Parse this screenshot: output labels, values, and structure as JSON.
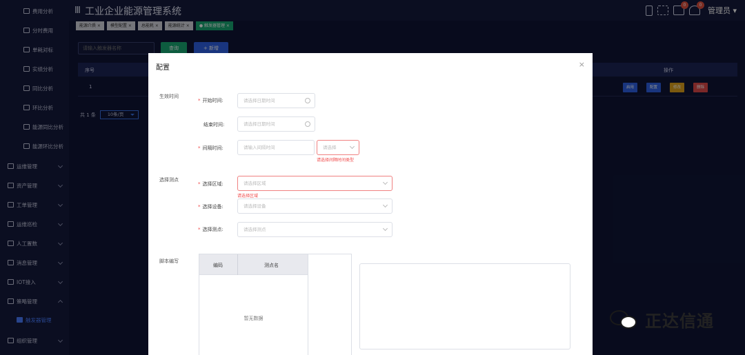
{
  "sidebar": {
    "items": [
      {
        "label": "费用分析",
        "icon": "home-icon",
        "level": "child"
      },
      {
        "label": "分时费用",
        "icon": "calendar-icon",
        "level": "child"
      },
      {
        "label": "单耗对标",
        "icon": "user-icon",
        "level": "child"
      },
      {
        "label": "实绩分析",
        "icon": "monitor-icon",
        "level": "child"
      },
      {
        "label": "同比分析",
        "icon": "calendar-icon",
        "level": "child"
      },
      {
        "label": "环比分析",
        "icon": "grid-icon",
        "level": "child"
      },
      {
        "label": "能源同比分析",
        "icon": "chart-icon",
        "level": "child"
      },
      {
        "label": "能源环比分析",
        "icon": "table-icon",
        "level": "child"
      },
      {
        "label": "运维管理",
        "icon": "warning-icon",
        "level": "group"
      },
      {
        "label": "资产管理",
        "icon": "image-icon",
        "level": "group"
      },
      {
        "label": "工单管理",
        "icon": "monitor-icon",
        "level": "group"
      },
      {
        "label": "运维巡检",
        "icon": "user-icon",
        "level": "group"
      },
      {
        "label": "人工置数",
        "icon": "person-card-icon",
        "level": "group"
      },
      {
        "label": "消息管理",
        "icon": "message-icon",
        "level": "group"
      },
      {
        "label": "IOT接入",
        "icon": "iot-icon",
        "level": "group"
      },
      {
        "label": "策略管理",
        "icon": "monitor-icon",
        "level": "group"
      },
      {
        "label": "触发器管理",
        "icon": "monitor-icon",
        "level": "active"
      },
      {
        "label": "组织管理",
        "icon": "org-icon",
        "level": "group"
      }
    ]
  },
  "header": {
    "title": "工业企业能源管理系统",
    "menu_icon": "Ⅲ",
    "message_badge": "0",
    "notify_badge": "0",
    "user": "管理员"
  },
  "tabs": [
    {
      "label": "能源介质",
      "active": false
    },
    {
      "label": "模型配置",
      "active": false
    },
    {
      "label": "总能耗",
      "active": false
    },
    {
      "label": "能源统计",
      "active": false
    },
    {
      "label": "触发器管理",
      "active": true
    }
  ],
  "toolbar": {
    "search_placeholder": "请输入触发器名称",
    "query_label": "查询",
    "add_label": "+ 新增"
  },
  "table": {
    "col_index": "序号",
    "col_action": "操作",
    "row_index": "1",
    "row_buttons": [
      {
        "label": "启用",
        "color": "#2f62e6"
      },
      {
        "label": "配置",
        "color": "#2f62e6"
      },
      {
        "label": "修改",
        "color": "#e0a21c"
      },
      {
        "label": "删除",
        "color": "#e04a4a"
      }
    ]
  },
  "pager": {
    "total": "共 1 条",
    "page_size": "10条/页"
  },
  "modal": {
    "title": "配置",
    "close": "×",
    "sections": {
      "effective_time": "生效时间",
      "select_points": "选择测点",
      "script": "脚本编写"
    },
    "start_label": "开始时间:",
    "start_placeholder": "请选择日期时间",
    "end_label": "结束时间:",
    "end_placeholder": "请选择日期时间",
    "interval_label": "间隔时间:",
    "interval_placeholder": "请输入间隔时间",
    "interval_type_placeholder": "请选择",
    "interval_type_error": "请选择间隔时间类型",
    "area_label": "选择区域:",
    "area_placeholder": "请选择区域",
    "area_error": "请选择区域",
    "device_label": "选择设备:",
    "device_placeholder": "请选择设备",
    "point_label": "选择测点:",
    "point_placeholder": "请选择测点",
    "points_table": {
      "col_code": "编码",
      "col_name": "测点名",
      "empty": "暂无数据"
    }
  },
  "watermark": {
    "text": "正达信通"
  },
  "colors": {
    "accent_blue": "#2f62e6",
    "accent_green": "#18a874",
    "error_red": "#f04a4a",
    "sidebar_bg": "#141a3d"
  }
}
